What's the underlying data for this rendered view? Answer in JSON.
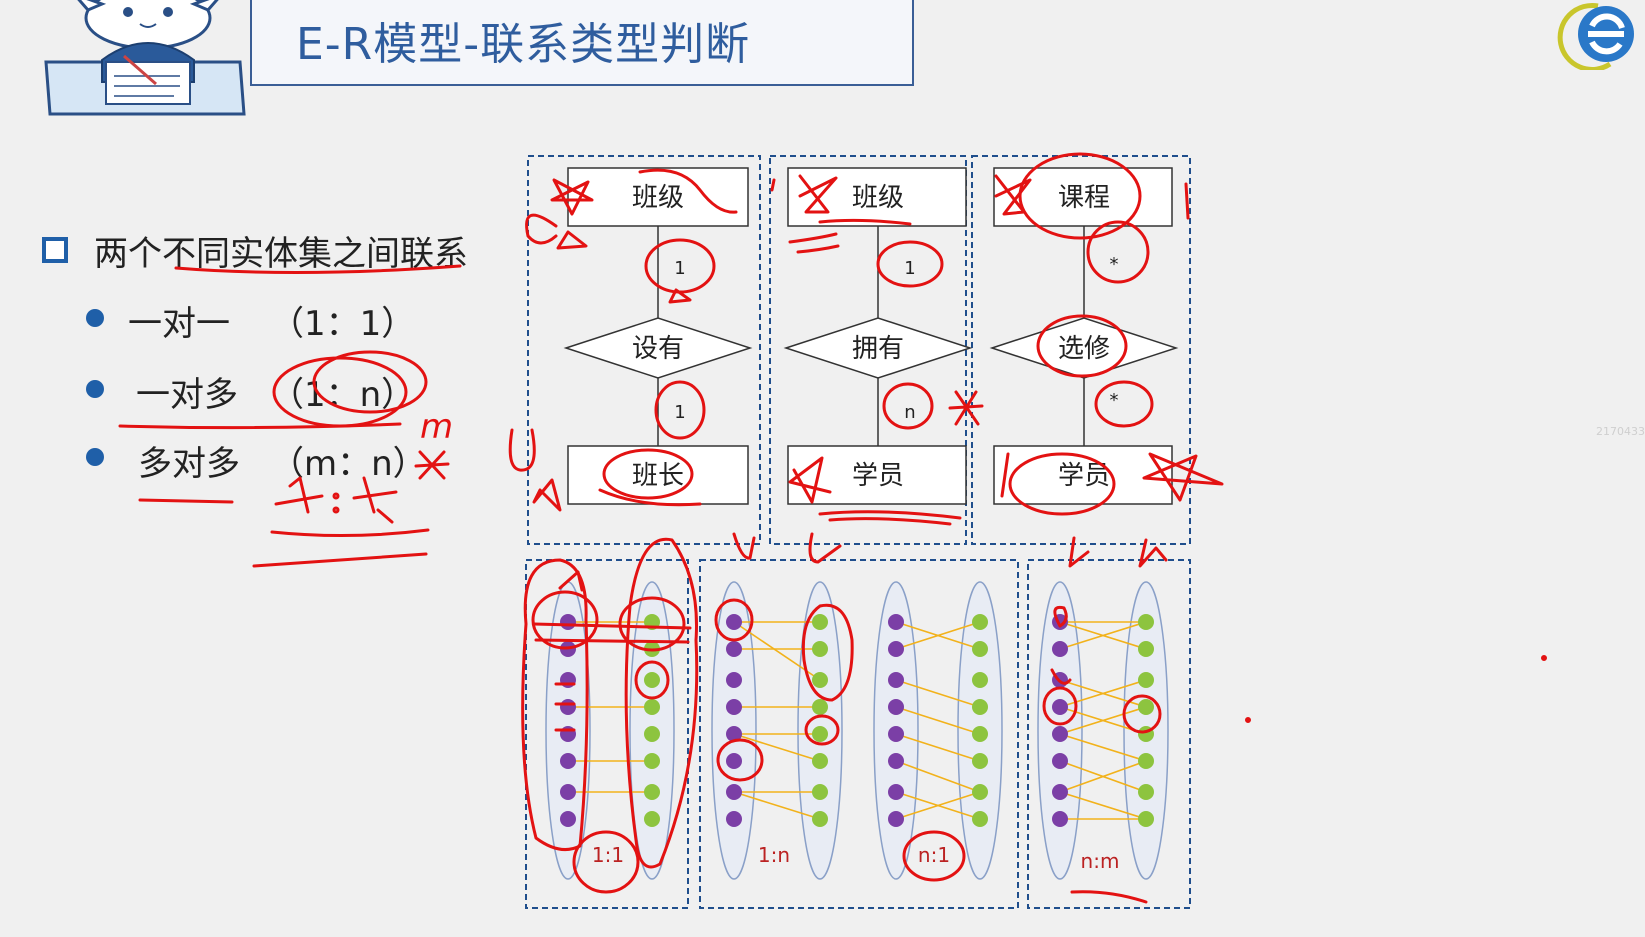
{
  "slide": {
    "title": "E-R模型-联系类型判断",
    "heading": "两个不同实体集之间联系",
    "items": [
      {
        "label": "一对一",
        "ratio": "（1：1）"
      },
      {
        "label": "一对多",
        "ratio": "（1：n）"
      },
      {
        "label": "多对多",
        "ratio": "（m：n）"
      }
    ],
    "watermark": "2170433"
  },
  "er_diagrams": [
    {
      "top_entity": "班级",
      "relation": "设有",
      "top_card": "1",
      "bottom_card": "1",
      "bottom_entity": "班长"
    },
    {
      "top_entity": "班级",
      "relation": "拥有",
      "top_card": "1",
      "bottom_card": "n",
      "bottom_entity": "学员"
    },
    {
      "top_entity": "课程",
      "relation": "选修",
      "top_card": "*",
      "bottom_card": "*",
      "bottom_entity": "学员"
    }
  ],
  "mapping_labels": {
    "one_to_one": "1:1",
    "one_to_many": "1:n",
    "many_to_one": "n:1",
    "many_to_many": "n:m"
  },
  "annotations": {
    "m_note": "m",
    "star_ratio": "*：*"
  },
  "colors": {
    "title_blue": "#2f5d9e",
    "bullet_blue": "#1f5fa8",
    "dash_blue": "#1f4e8c",
    "left_dot": "#7b3fa6",
    "right_dot": "#8dc43f",
    "link_line": "#f2b21b",
    "ink_red": "#e31212"
  }
}
